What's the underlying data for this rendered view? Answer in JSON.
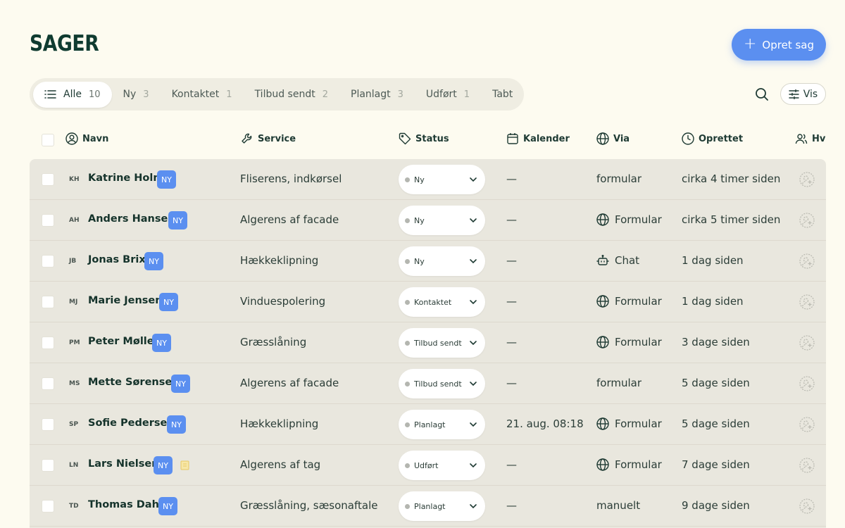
{
  "page": {
    "title": "SAGER",
    "create_label": "Opret sag",
    "view_label": "Vis"
  },
  "colors": {
    "background": "#fdfbf0",
    "accent": "#5b8ff0",
    "table_bg": "#e9e7de",
    "text": "#1e3a33"
  },
  "tabs": [
    {
      "label": "Alle",
      "count": "10",
      "active": true
    },
    {
      "label": "Ny",
      "count": "3"
    },
    {
      "label": "Kontaktet",
      "count": "1"
    },
    {
      "label": "Tilbud sendt",
      "count": "2"
    },
    {
      "label": "Planlagt",
      "count": "3"
    },
    {
      "label": "Udført",
      "count": "1"
    },
    {
      "label": "Tabt",
      "count": ""
    }
  ],
  "columns": {
    "name": "Navn",
    "service": "Service",
    "status": "Status",
    "calendar": "Kalender",
    "via": "Via",
    "created": "Oprettet",
    "assignee": "Hvem"
  },
  "rows": [
    {
      "initials": "KH",
      "name": "Katrine Holm",
      "badge": "NY",
      "service": "Fliserens, indkørsel",
      "status": "Ny",
      "calendar": "—",
      "via": "formular",
      "via_icon": "",
      "created": "cirka 4 timer siden"
    },
    {
      "initials": "AH",
      "name": "Anders Hansen",
      "badge": "NY",
      "service": "Algerens af facade",
      "status": "Ny",
      "calendar": "—",
      "via": "Formular",
      "via_icon": "globe-icon",
      "created": "cirka 5 timer siden"
    },
    {
      "initials": "JB",
      "name": "Jonas Brix",
      "badge": "NY",
      "service": "Hækkeklipning",
      "status": "Ny",
      "calendar": "—",
      "via": "Chat",
      "via_icon": "bot-icon",
      "created": "1 dag siden"
    },
    {
      "initials": "MJ",
      "name": "Marie Jensen",
      "badge": "NY",
      "service": "Vinduespolering",
      "status": "Kontaktet",
      "calendar": "—",
      "via": "Formular",
      "via_icon": "globe-icon",
      "created": "1 dag siden"
    },
    {
      "initials": "PM",
      "name": "Peter Møller",
      "badge": "NY",
      "service": "Græsslåning",
      "status": "Tilbud sendt",
      "calendar": "—",
      "via": "Formular",
      "via_icon": "globe-icon",
      "created": "3 dage siden"
    },
    {
      "initials": "MS",
      "name": "Mette Sørensen",
      "badge": "NY",
      "service": "Algerens af facade",
      "status": "Tilbud sendt",
      "calendar": "—",
      "via": "formular",
      "via_icon": "",
      "created": "5 dage siden"
    },
    {
      "initials": "SP",
      "name": "Sofie Pedersen",
      "badge": "NY",
      "service": "Hækkeklipning",
      "status": "Planlagt",
      "calendar": "21. aug. 08:18",
      "via": "Formular",
      "via_icon": "globe-icon",
      "created": "5 dage siden"
    },
    {
      "initials": "LN",
      "name": "Lars Nielsen",
      "badge": "NY",
      "note": true,
      "service": "Algerens af tag",
      "status": "Udført",
      "calendar": "—",
      "via": "Formular",
      "via_icon": "globe-icon",
      "created": "7 dage siden"
    },
    {
      "initials": "TD",
      "name": "Thomas Dahl",
      "badge": "NY",
      "service": "Græsslåning, sæsonaftale",
      "status": "Planlagt",
      "calendar": "—",
      "via": "manuelt",
      "via_icon": "",
      "created": "9 dage siden"
    }
  ]
}
